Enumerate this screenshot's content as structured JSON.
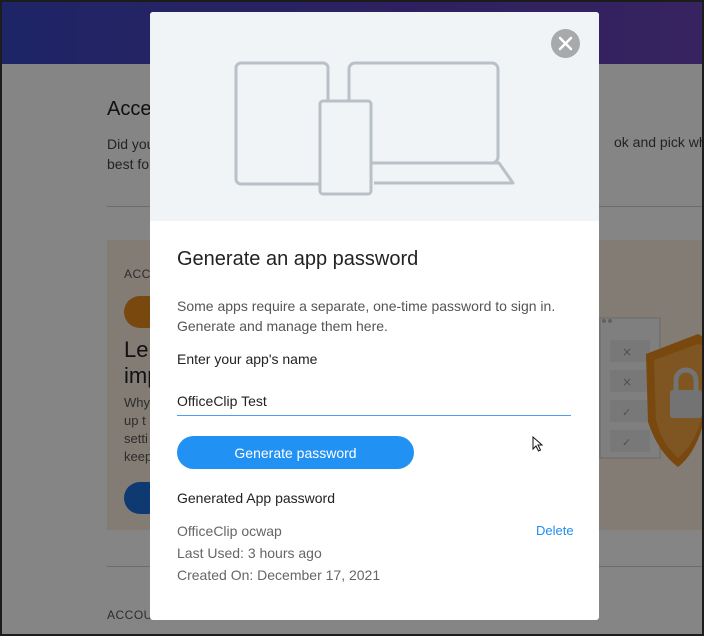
{
  "background": {
    "title": "Acce",
    "description": "Did you",
    "description_line2": "best fo",
    "description_right": "ok and pick what'",
    "card": {
      "label": "ACC",
      "heading": "Le",
      "heading_line2": "imp",
      "body_lines": [
        "Why",
        "up t",
        "setti",
        "keep"
      ]
    },
    "footer_label": "ACCOU"
  },
  "modal": {
    "title": "Generate an app password",
    "description": "Some apps require a separate, one-time password to sign in. Generate and manage them here.",
    "input_label": "Enter your app's name",
    "input_value": "OfficeClip Test",
    "generate_button": "Generate password",
    "generated_section_title": "Generated App password",
    "password_entry": {
      "name": "OfficeClip ocwap",
      "last_used": "Last Used: 3 hours ago",
      "created_on": "Created On: December 17, 2021",
      "delete_label": "Delete"
    }
  },
  "icons": {
    "close": "close-icon",
    "devices": "devices-illustration-icon",
    "shield": "shield-lock-icon",
    "cursor": "mouse-cursor-icon"
  },
  "colors": {
    "header_gradient_start": "#3a47c4",
    "header_gradient_end": "#6a44b8",
    "accent_blue": "#2192f4",
    "link_blue": "#1f8ef1",
    "card_orange": "#e98a1e",
    "hero_bg": "#f1f4f7"
  }
}
